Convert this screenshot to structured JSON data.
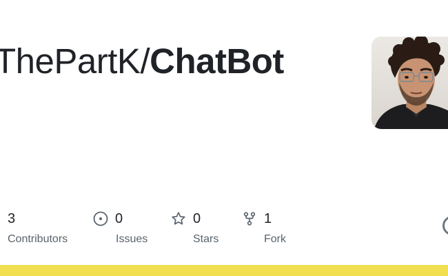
{
  "repo": {
    "owner": "ThePartK",
    "separator": "/",
    "name": "ChatBot"
  },
  "stats": {
    "contributors": {
      "value": "3",
      "label": "Contributors"
    },
    "issues": {
      "value": "0",
      "label": "Issues",
      "icon": "issue-opened-icon"
    },
    "stars": {
      "value": "0",
      "label": "Stars",
      "icon": "star-icon"
    },
    "forks": {
      "value": "1",
      "label": "Fork",
      "icon": "repo-forked-icon"
    }
  },
  "colors": {
    "text": "#1f2328",
    "muted": "#59636e",
    "accent_bar": "#f1df50",
    "language_ring": "#6e7681"
  },
  "icons": {
    "corner": "github-mark-icon"
  }
}
